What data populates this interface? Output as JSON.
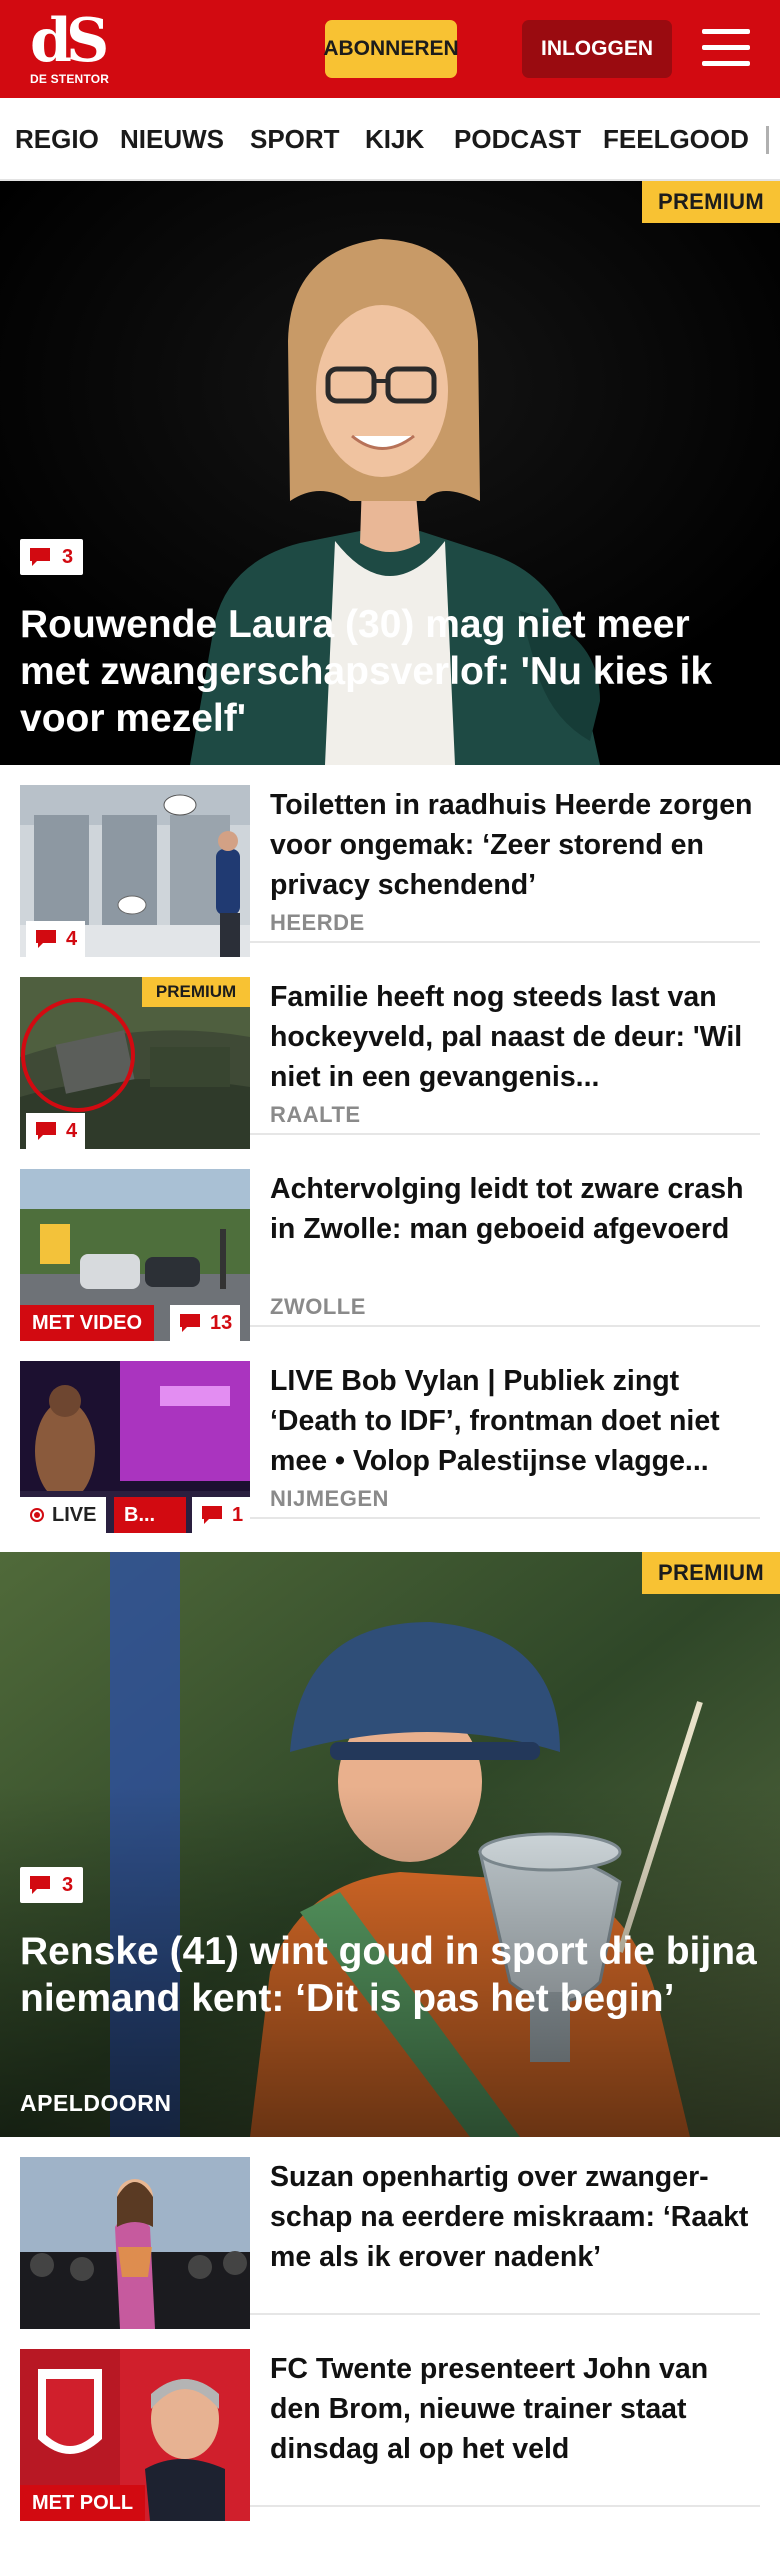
{
  "header": {
    "logo_mark": "dS",
    "logo_sub": "DE STENTOR",
    "subscribe_label": "ABONNEREN",
    "login_label": "INLOGGEN",
    "menu_icon": "hamburger-menu-icon"
  },
  "nav": {
    "items": [
      "REGIO",
      "NIEUWS",
      "SPORT",
      "KIJK",
      "PODCAST",
      "FEELGOOD"
    ]
  },
  "hero1": {
    "premium": "PREMIUM",
    "comments": "3",
    "title": "Rouwende Laura (30) mag niet meer met zwangerschapsverlof: 'Nu kies ik voor mezelf'"
  },
  "articles": [
    {
      "title": "Toiletten in raadhuis Heerde zorgen voor ongemak: ‘Zeer storend en privacy schendend’",
      "region": "HEERDE",
      "comments": "4"
    },
    {
      "title": "Familie heeft nog steeds last van hockeyveld, pal naast de deur: 'Wil niet in een gevangenis...",
      "region": "RAALTE",
      "comments": "4",
      "premium": "PREMIUM"
    },
    {
      "title": "Achtervolging leidt tot zware crash in Zwolle: man geboeid afgevoerd",
      "region": "ZWOLLE",
      "comments": "13",
      "tag": "MET VIDEO"
    },
    {
      "title": "LIVE Bob Vylan | Publiek zingt ‘Death to IDF’, frontman doet niet mee • Volop Palestijnse vlagge...",
      "region": "NIJMEGEN",
      "comments": "1",
      "live": "LIVE",
      "tag": "B..."
    }
  ],
  "hero2": {
    "premium": "PREMIUM",
    "comments": "3",
    "title": "Renske (41) wint goud in sport die bijna niemand kent: ‘Dit is pas het begin’",
    "region": "APELDOORN"
  },
  "articles2": [
    {
      "title": "Suzan openhartig over zwanger-schap na eerdere miskraam: ‘Raakt me als ik erover nadenk’"
    },
    {
      "title": "FC Twente presenteert John van den Brom, nieuwe trainer staat dinsdag al op het veld",
      "tag": "MET POLL"
    }
  ],
  "colors": {
    "brand_red": "#d20a11",
    "premium_yellow": "#f8c233",
    "login_dark_red": "#9a0b10"
  }
}
